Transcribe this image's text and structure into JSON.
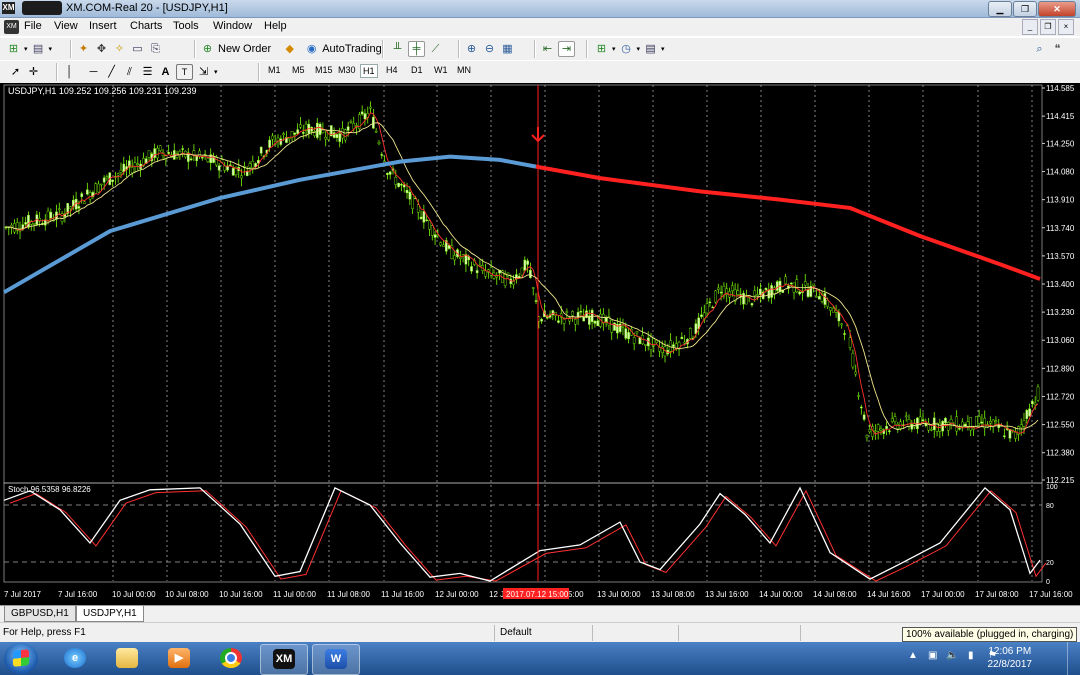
{
  "window": {
    "title": "XM.COM-Real 20 - [USDJPY,H1]",
    "app_icon_text": "XM"
  },
  "menu": [
    "File",
    "View",
    "Insert",
    "Charts",
    "Tools",
    "Window",
    "Help"
  ],
  "toolbar": {
    "new_order": "New Order",
    "auto_trading": "AutoTrading"
  },
  "timeframes": [
    "M1",
    "M5",
    "M15",
    "M30",
    "H1",
    "H4",
    "D1",
    "W1",
    "MN"
  ],
  "active_timeframe": "H1",
  "drawing_tools": {
    "text_tool": "A",
    "label_tool": "T"
  },
  "chart": {
    "header": "USDJPY,H1  109.252 109.256 109.231 109.239",
    "price_axis": [
      "114.585",
      "114.415",
      "114.250",
      "114.080",
      "113.910",
      "113.740",
      "113.570",
      "113.400",
      "113.230",
      "113.060",
      "112.890",
      "112.720",
      "112.550",
      "112.380",
      "112.215"
    ],
    "stoch_header": "Stoch        96.5358 96.8226",
    "stoch_axis": [
      "100",
      "80",
      "20",
      "0"
    ],
    "time_axis": [
      "7 Jul 2017",
      "7 Jul 16:00",
      "10 Jul 00:00",
      "10 Jul 08:00",
      "10 Jul 16:00",
      "11 Jul 00:00",
      "11 Jul 08:00",
      "11 Jul 16:00",
      "12 Jul 00:00",
      "12 J",
      "5:00",
      "13 Jul 00:00",
      "13 Jul 08:00",
      "13 Jul 16:00",
      "14 Jul 00:00",
      "14 Jul 08:00",
      "14 Jul 16:00",
      "17 Jul 00:00",
      "17 Jul 08:00",
      "17 Jul 16:00"
    ],
    "cursor_time_label": "2017.07.12 15:00",
    "colors": {
      "background": "#000000",
      "bull_candle": "#d8f5b0",
      "bear_candle": "#000000",
      "candle_outline": "#7cfc00",
      "ma_fast": "#ff3030",
      "ma_slow": "#f0e68c",
      "ma_long_past": "#5b9bd5",
      "ma_long_future": "#ff2020",
      "stoch_main": "#ffffff",
      "stoch_signal": "#ff3030",
      "cursor_line": "#ff2020"
    }
  },
  "tabs": [
    "GBPUSD,H1",
    "USDJPY,H1"
  ],
  "active_tab": "USDJPY,H1",
  "status": {
    "help": "For Help, press F1",
    "profile": "Default",
    "battery_tooltip": "100% available (plugged in, charging)"
  },
  "taskbar": {
    "apps": [
      "internet-explorer",
      "file-explorer",
      "media-player",
      "chrome",
      "xm-terminal",
      "word"
    ],
    "xm_label": "XM",
    "word_label": "W",
    "time": "12:06 PM",
    "date": "22/8/2017"
  }
}
